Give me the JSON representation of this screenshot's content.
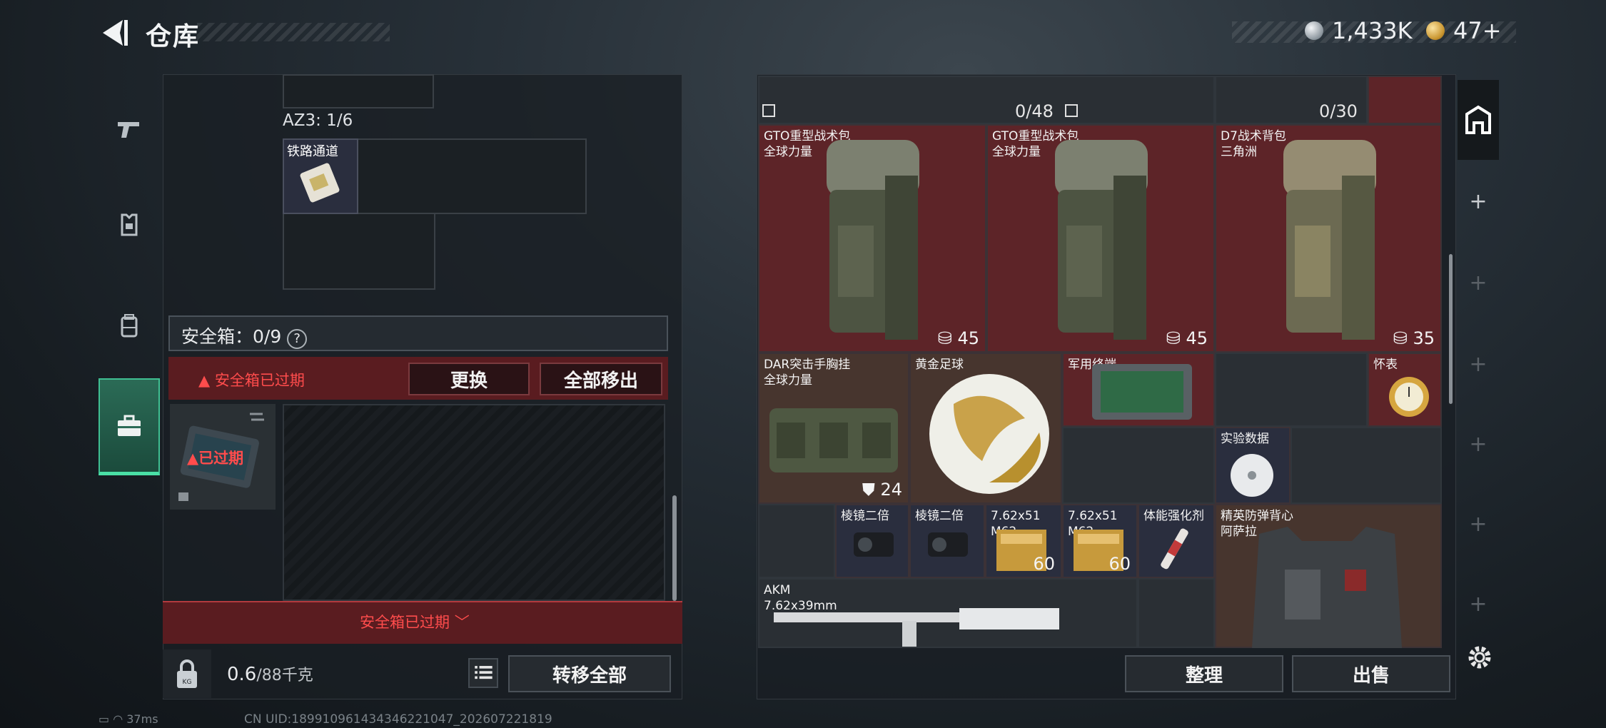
{
  "header": {
    "title": "仓库",
    "currency_silver": "1,433K",
    "currency_gold": "47+"
  },
  "left_panel": {
    "az3_label": "AZ3: 1/6",
    "rail_item_label": "铁路通道",
    "safebox_label": "安全箱：0/9",
    "safebox_help": "?",
    "expired_warning": "安全箱已过期",
    "swap_button": "更换",
    "move_all_out_button": "全部移出",
    "case_expired_label": "已过期",
    "expired_footer": "安全箱已过期",
    "weight": "0.6",
    "weight_max": "/88千克",
    "transfer_all_button": "转移全部"
  },
  "right_panel": {
    "capacity_1": "0/48",
    "capacity_2": "0/30",
    "items": [
      {
        "name": "GTO重型战术包\n全球力量",
        "count": "45"
      },
      {
        "name": "GTO重型战术包\n全球力量",
        "count": "45"
      },
      {
        "name": "D7战术背包\n三角洲",
        "count": "35"
      },
      {
        "name": "DAR突击手胸挂\n全球力量",
        "count": "24"
      },
      {
        "name": "黄金足球",
        "count": ""
      },
      {
        "name": "军用终端",
        "count": ""
      },
      {
        "name": "怀表",
        "count": ""
      },
      {
        "name": "实验数据",
        "count": ""
      },
      {
        "name": "棱镜二倍",
        "count": ""
      },
      {
        "name": "棱镜二倍",
        "count": ""
      },
      {
        "name": "7.62x51\nM62",
        "count": "60"
      },
      {
        "name": "7.62x51\nM62",
        "count": "60"
      },
      {
        "name": "体能强化剂",
        "count": ""
      },
      {
        "name": "精英防弹背心\n阿萨拉",
        "count": ""
      },
      {
        "name": "AKM\n7.62x39mm",
        "count": ""
      }
    ],
    "sort_button": "整理",
    "sell_button": "出售"
  },
  "right_tabs": {
    "add": "+"
  },
  "status": {
    "ping": "37ms",
    "uid": "CN UID:18991096143434622​1047_202607221819"
  },
  "colors": {
    "accent_green": "#3fbf92",
    "danger_red": "#ff4c4c",
    "item_red": "#5d2428"
  }
}
